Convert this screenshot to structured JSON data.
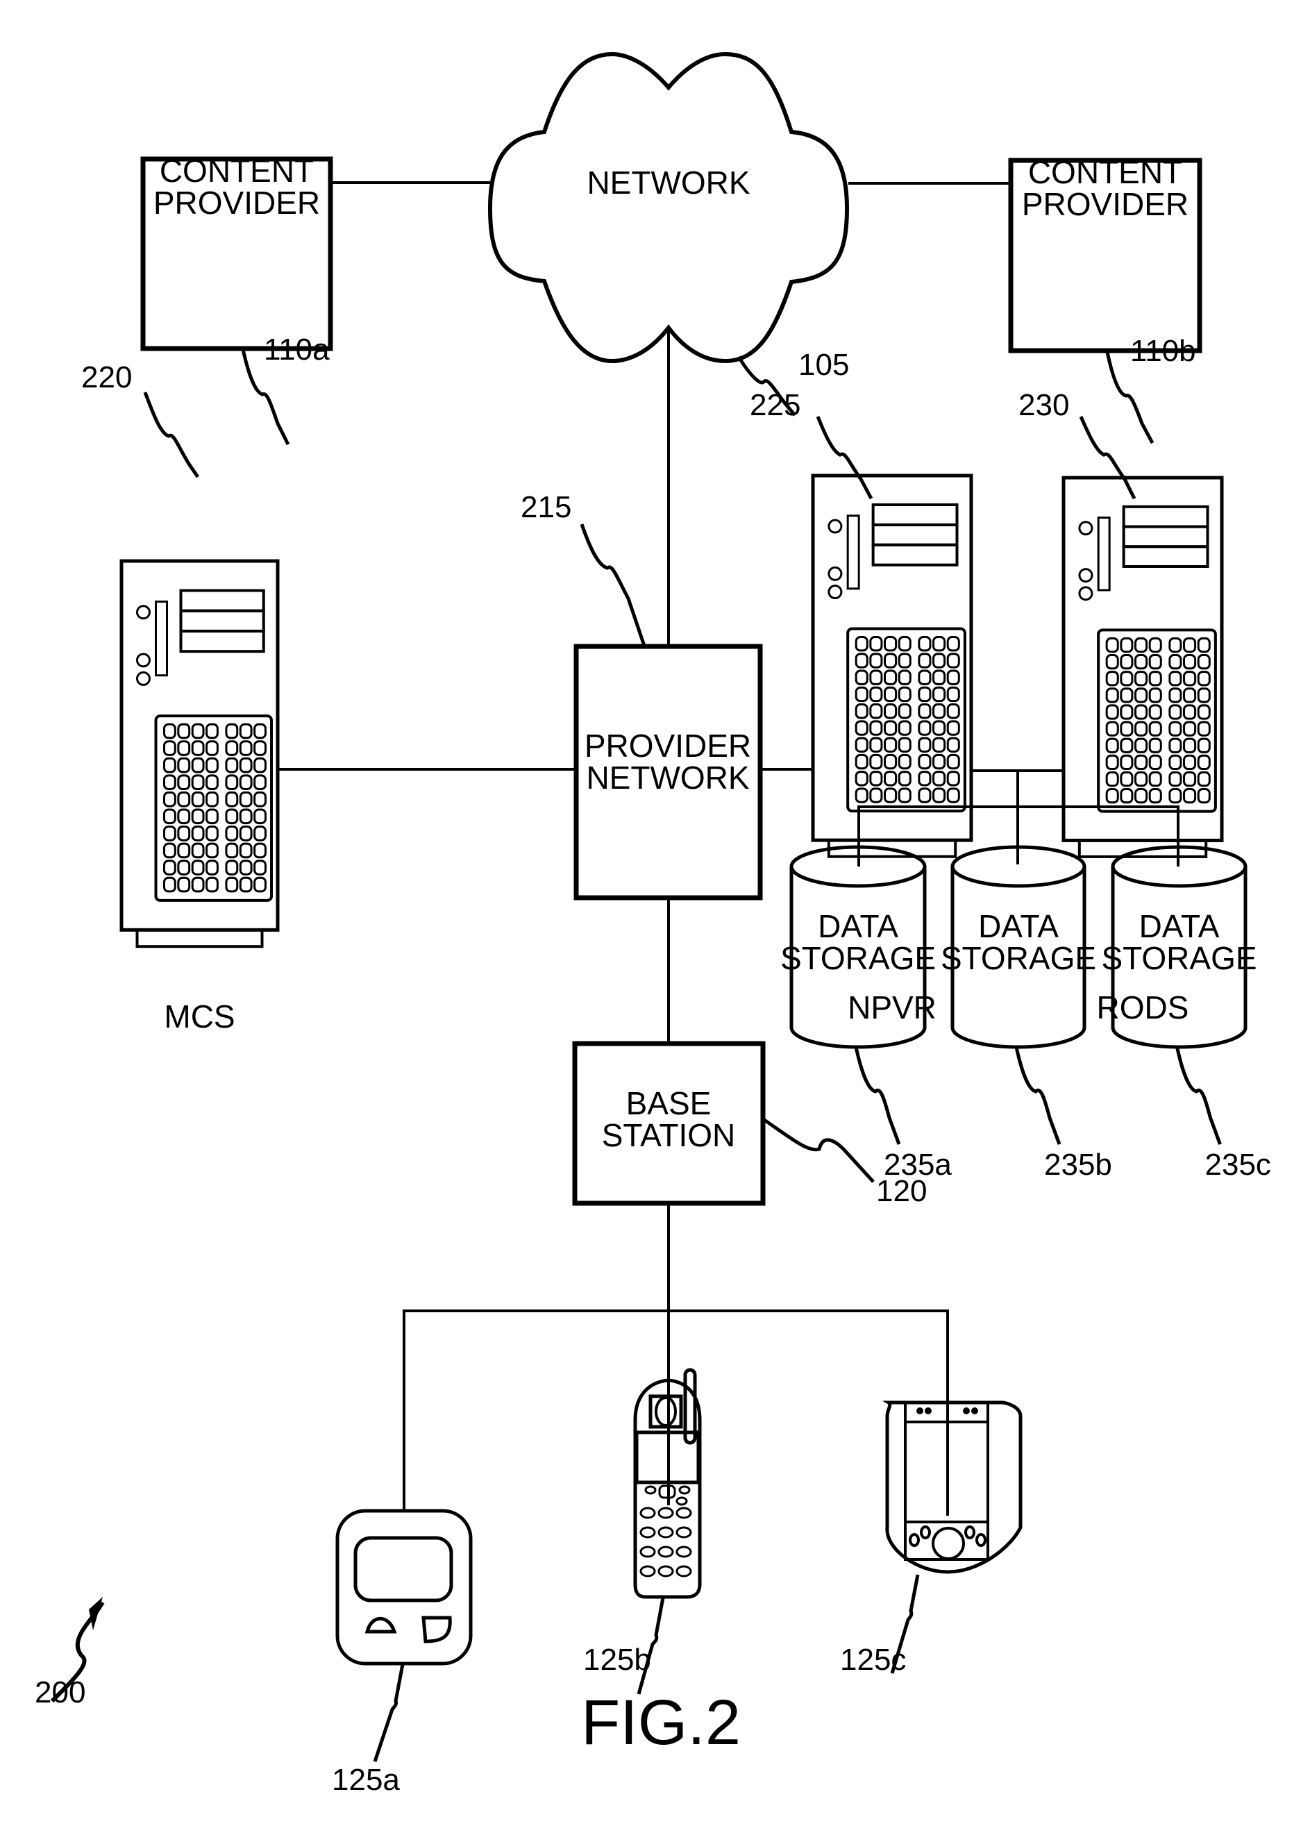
{
  "figure": {
    "title": "FIG.2",
    "reference": "200"
  },
  "network": {
    "label": "NETWORK",
    "ref": "105"
  },
  "content_providers": [
    {
      "line1": "CONTENT",
      "line2": "PROVIDER",
      "ref": "110a"
    },
    {
      "line1": "CONTENT",
      "line2": "PROVIDER",
      "ref": "110b"
    }
  ],
  "provider_network": {
    "line1": "PROVIDER",
    "line2": "NETWORK",
    "ref": "215"
  },
  "servers": [
    {
      "label": "MCS",
      "ref": "220"
    },
    {
      "label": "NPVR",
      "ref": "225"
    },
    {
      "label": "RODS",
      "ref": "230"
    }
  ],
  "data_storage": [
    {
      "line1": "DATA",
      "line2": "STORAGE",
      "ref": "235a"
    },
    {
      "line1": "DATA",
      "line2": "STORAGE",
      "ref": "235b"
    },
    {
      "line1": "DATA",
      "line2": "STORAGE",
      "ref": "235c"
    }
  ],
  "base_station": {
    "line1": "BASE",
    "line2": "STATION",
    "ref": "120"
  },
  "devices": [
    {
      "type": "pager",
      "ref": "125a"
    },
    {
      "type": "cell-phone",
      "ref": "125b"
    },
    {
      "type": "pda",
      "ref": "125c"
    }
  ]
}
